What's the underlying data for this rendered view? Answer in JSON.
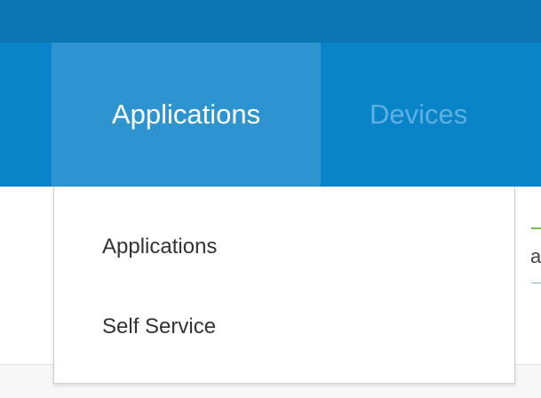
{
  "nav": {
    "tabs": [
      {
        "label": "Applications",
        "active": true
      },
      {
        "label": "Devices",
        "active": false
      }
    ]
  },
  "dropdown": {
    "items": [
      {
        "label": "Applications"
      },
      {
        "label": "Self Service"
      }
    ]
  },
  "peek": {
    "text": "a"
  },
  "colors": {
    "top_strip": "#0a76b2",
    "nav_bar": "#0a84c8",
    "active_tab": "#2d94d0",
    "inactive_tab_text": "#5fb0e0",
    "dropdown_text": "#333333"
  }
}
